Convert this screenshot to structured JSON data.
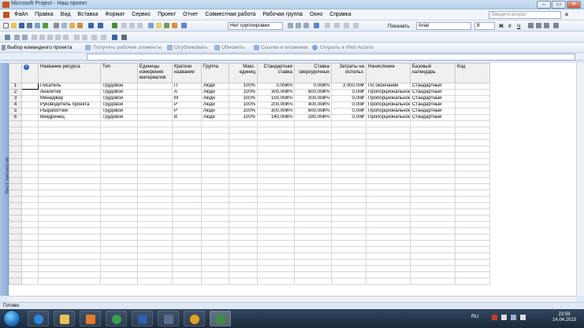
{
  "window": {
    "title": "Microsoft Project - Наш проект",
    "min": "–",
    "max": "▭",
    "close": "✕"
  },
  "menu": {
    "items": [
      "Файл",
      "Правка",
      "Вид",
      "Вставка",
      "Формат",
      "Сервис",
      "Проект",
      "Отчет",
      "Совместная работа",
      "Рабочая группа",
      "Окно",
      "Справка"
    ],
    "help_placeholder": "Введите вопрос"
  },
  "toolbar1": {
    "grouping": "Нет группировки",
    "show": "Показать",
    "font": "Arial",
    "size": "8",
    "bold": "Ж",
    "italic": "К",
    "underline": "Ч"
  },
  "toolbar3": {
    "team": "Выбор командного проекта",
    "get_items": "Получить рабочие элементы",
    "publish": "Опубликовать",
    "refresh": "Обновить",
    "links": "Ссылки и вложения",
    "web": "Открыть в Web Access"
  },
  "grid": {
    "headers": [
      "",
      "ⓘ",
      "Название ресурса",
      "Тип",
      "Единицы измерения материалов",
      "Краткое название",
      "Группа",
      "Макс. единиц",
      "Стандартная ставка",
      "Ставка сверхурочных",
      "Затраты на использ.",
      "Начисление",
      "Базовый календарь",
      "Код"
    ],
    "rows": [
      [
        "1",
        "",
        "Писатель",
        "Трудовой",
        "",
        "П",
        "люди",
        "100%",
        "0,00₽/ч",
        "0,00₽/ч",
        "3 000,00₽",
        "По окончании",
        "Стандартный",
        ""
      ],
      [
        "2",
        "",
        "Аналитик",
        "Трудовой",
        "",
        "А",
        "люди",
        "100%",
        "300,00₽/ч",
        "600,00₽/ч",
        "0,00₽",
        "Пропорциональное",
        "Стандартный",
        ""
      ],
      [
        "3",
        "",
        "Менеджер",
        "Трудовой",
        "",
        "М",
        "люди",
        "100%",
        "150,00₽/ч",
        "300,00₽/ч",
        "0,00₽",
        "Пропорциональное",
        "Стандартный",
        ""
      ],
      [
        "4",
        "",
        "Руководитель проекта",
        "Трудовой",
        "",
        "Р",
        "люди",
        "100%",
        "200,00₽/ч",
        "400,00₽/ч",
        "0,00₽",
        "Пропорциональное",
        "Стандартный",
        ""
      ],
      [
        "5",
        "",
        "Разработчик",
        "Трудовой",
        "",
        "Р",
        "люди",
        "100%",
        "300,00₽/ч",
        "600,00₽/ч",
        "0,00₽",
        "Пропорциональное",
        "Стандартный",
        ""
      ],
      [
        "6",
        "",
        "Внедренец",
        "Трудовой",
        "",
        "В",
        "люди",
        "100%",
        "140,00₽/ч",
        "280,00₽/ч",
        "0,00₽",
        "Пропорциональное",
        "Стандартный",
        ""
      ]
    ]
  },
  "view_bar": {
    "label": "Лист ресурсов"
  },
  "status": {
    "text": "Готово"
  },
  "taskbar": {
    "lang": "RU",
    "time": "23:59",
    "date": "14.04.2013"
  }
}
